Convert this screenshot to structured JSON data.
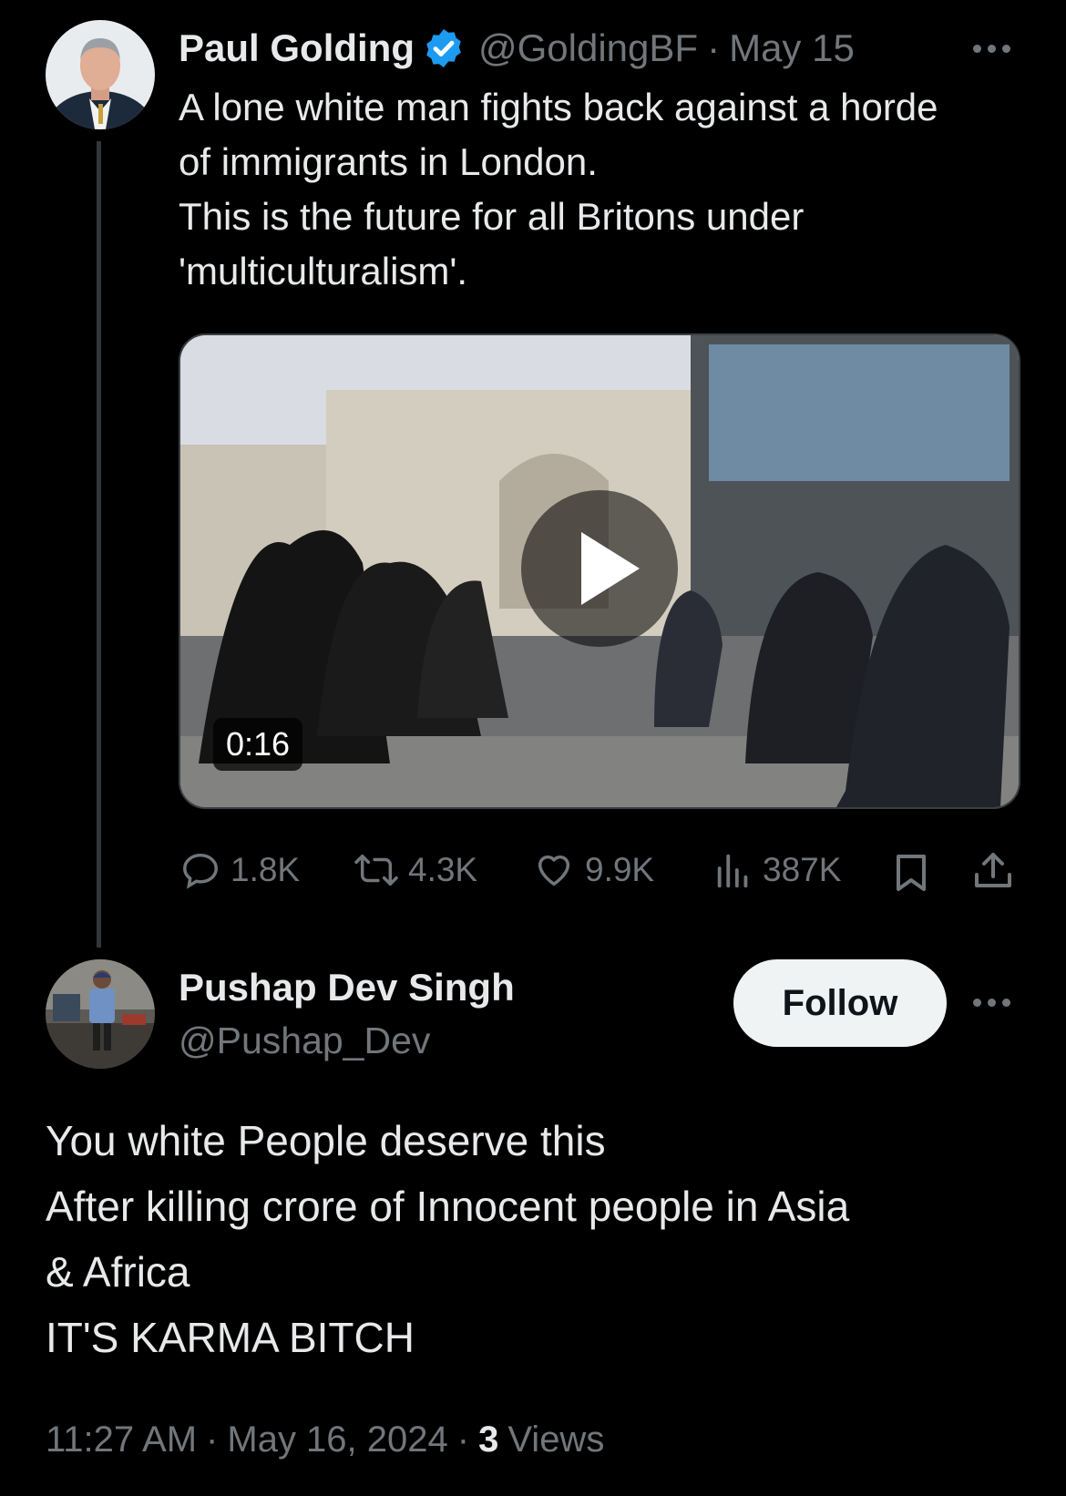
{
  "original_tweet": {
    "author_name": "Paul Golding",
    "handle": "@GoldingBF",
    "separator": "·",
    "date": "May 15",
    "text": "A lone white man fights back against a horde\nof immigrants in London.\nThis is the future for all Britons under\n'multiculturalism'.",
    "video": {
      "duration": "0:16"
    },
    "metrics": {
      "replies": "1.8K",
      "retweets": "4.3K",
      "likes": "9.9K",
      "views": "387K"
    },
    "verified": true
  },
  "reply_tweet": {
    "author_name": "Pushap Dev Singh",
    "handle": "@Pushap_Dev",
    "follow_label": "Follow",
    "text": "You white People deserve this\nAfter killing crore of Innocent people  in Asia\n& Africa\nIT'S KARMA  BITCH",
    "time": "11:27 AM",
    "sep1": "·",
    "date": "May 16, 2024",
    "sep2": "·",
    "views_count": "3",
    "views_label": "Views"
  },
  "colors": {
    "background": "#000000",
    "text": "#e7e9ea",
    "muted": "#71767b",
    "verified": "#1d9bf0"
  },
  "icons": [
    "more-icon",
    "verified-badge-icon",
    "play-icon",
    "reply-icon",
    "retweet-icon",
    "like-icon",
    "views-icon",
    "bookmark-icon",
    "share-icon"
  ]
}
